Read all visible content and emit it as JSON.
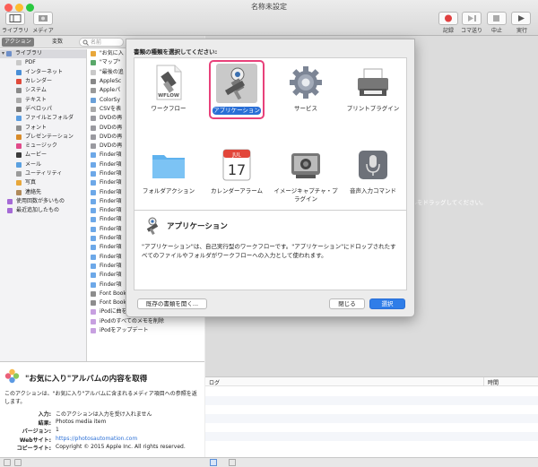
{
  "window": {
    "title": "名称未設定"
  },
  "toolbar": {
    "library": "ライブラリ",
    "media": "メディア",
    "record": "記録",
    "step": "コマ送り",
    "stop": "中止",
    "run": "実行"
  },
  "tabs": {
    "actions": "アクション",
    "variables": "変数",
    "search_placeholder": "名前"
  },
  "library": [
    {
      "label": "ライブラリ",
      "color": "#6e8fc9",
      "selected": true
    },
    {
      "label": "PDF",
      "color": "#c9c9c9"
    },
    {
      "label": "インターネット",
      "color": "#4a8fd6"
    },
    {
      "label": "カレンダー",
      "color": "#e04a3b"
    },
    {
      "label": "システム",
      "color": "#8a8a8a"
    },
    {
      "label": "テキスト",
      "color": "#aaaaaa"
    },
    {
      "label": "デベロッパ",
      "color": "#7a7a7a"
    },
    {
      "label": "ファイルとフォルダ",
      "color": "#5b9de0"
    },
    {
      "label": "フォント",
      "color": "#8d8d8d"
    },
    {
      "label": "プレゼンテーション",
      "color": "#d88b2a"
    },
    {
      "label": "ミュージック",
      "color": "#e04a8a"
    },
    {
      "label": "ムービー",
      "color": "#3b3b3b"
    },
    {
      "label": "メール",
      "color": "#5aa0e0"
    },
    {
      "label": "ユーティリティ",
      "color": "#9a9a9a"
    },
    {
      "label": "写真",
      "color": "#e8a73b"
    },
    {
      "label": "連絡先",
      "color": "#b08a5a"
    },
    {
      "label": "使用回数が多いもの",
      "color": "#a56ad6"
    },
    {
      "label": "最近追加したもの",
      "color": "#a56ad6"
    }
  ],
  "actions": [
    "\"お気に入",
    "\"マップ\"",
    "\"最後の追",
    "AppleSc",
    "Appleパ",
    "ColorSy",
    "CSVを表",
    "DVDの再",
    "DVDの再",
    "DVDの再",
    "DVDの再",
    "Finder項",
    "Finder項",
    "Finder項",
    "Finder項",
    "Finder項",
    "Finder項",
    "Finder項",
    "Finder項",
    "Finder項",
    "Finder項",
    "Finder項",
    "Finder項",
    "Finder項",
    "Finder項",
    "Finder項",
    "Font Book項目にフィルタを適用",
    "Font Book項目を検索",
    "iPodに曲を追加",
    "iPodのすべてのメモを削除",
    "iPodをアップデート"
  ],
  "dialog": {
    "prompt": "書類の種類を選択してください:",
    "types": [
      {
        "label": "ワークフロー",
        "selected": false
      },
      {
        "label": "アプリケーション",
        "selected": true
      },
      {
        "label": "サービス",
        "selected": false
      },
      {
        "label": "プリントプラグイン",
        "selected": false
      },
      {
        "label": "フォルダアクション",
        "selected": false
      },
      {
        "label": "カレンダーアラーム",
        "selected": false
      },
      {
        "label": "イメージキャプチャ・プラグイン",
        "selected": false
      },
      {
        "label": "音声入力コマンド",
        "selected": false
      }
    ],
    "wflow_badge": "WFLOW",
    "calendar_month": "JUL",
    "calendar_day": "17",
    "desc_title": "アプリケーション",
    "desc_text": "\"アプリケーション\"は、自己実行型のワークフローです。\"アプリケーション\"にドロップされたすべてのファイルやフォルダがワークフローへの入力として使われます。",
    "open_existing": "既存の書類を開く...",
    "close": "閉じる",
    "choose": "選択"
  },
  "workflow": {
    "drop_hint": "イルをドラッグしてください。"
  },
  "info": {
    "title": "\"お気に入り\"アルバムの内容を取得",
    "description": "このアクションは、\"お気に入り\"アルバムに含まれるメディア項目への参照を返します。",
    "rows": [
      {
        "key": "入力:",
        "value": "このアクションは入力を受け入れません"
      },
      {
        "key": "結果:",
        "value": "Photos media item"
      },
      {
        "key": "バージョン:",
        "value": "1"
      },
      {
        "key": "Webサイト:",
        "value": "https://photosautomation.com"
      },
      {
        "key": "コピーライト:",
        "value": "Copyright © 2015 Apple Inc. All rights reserved."
      }
    ]
  },
  "log": {
    "col_log": "ログ",
    "col_time": "時間"
  }
}
